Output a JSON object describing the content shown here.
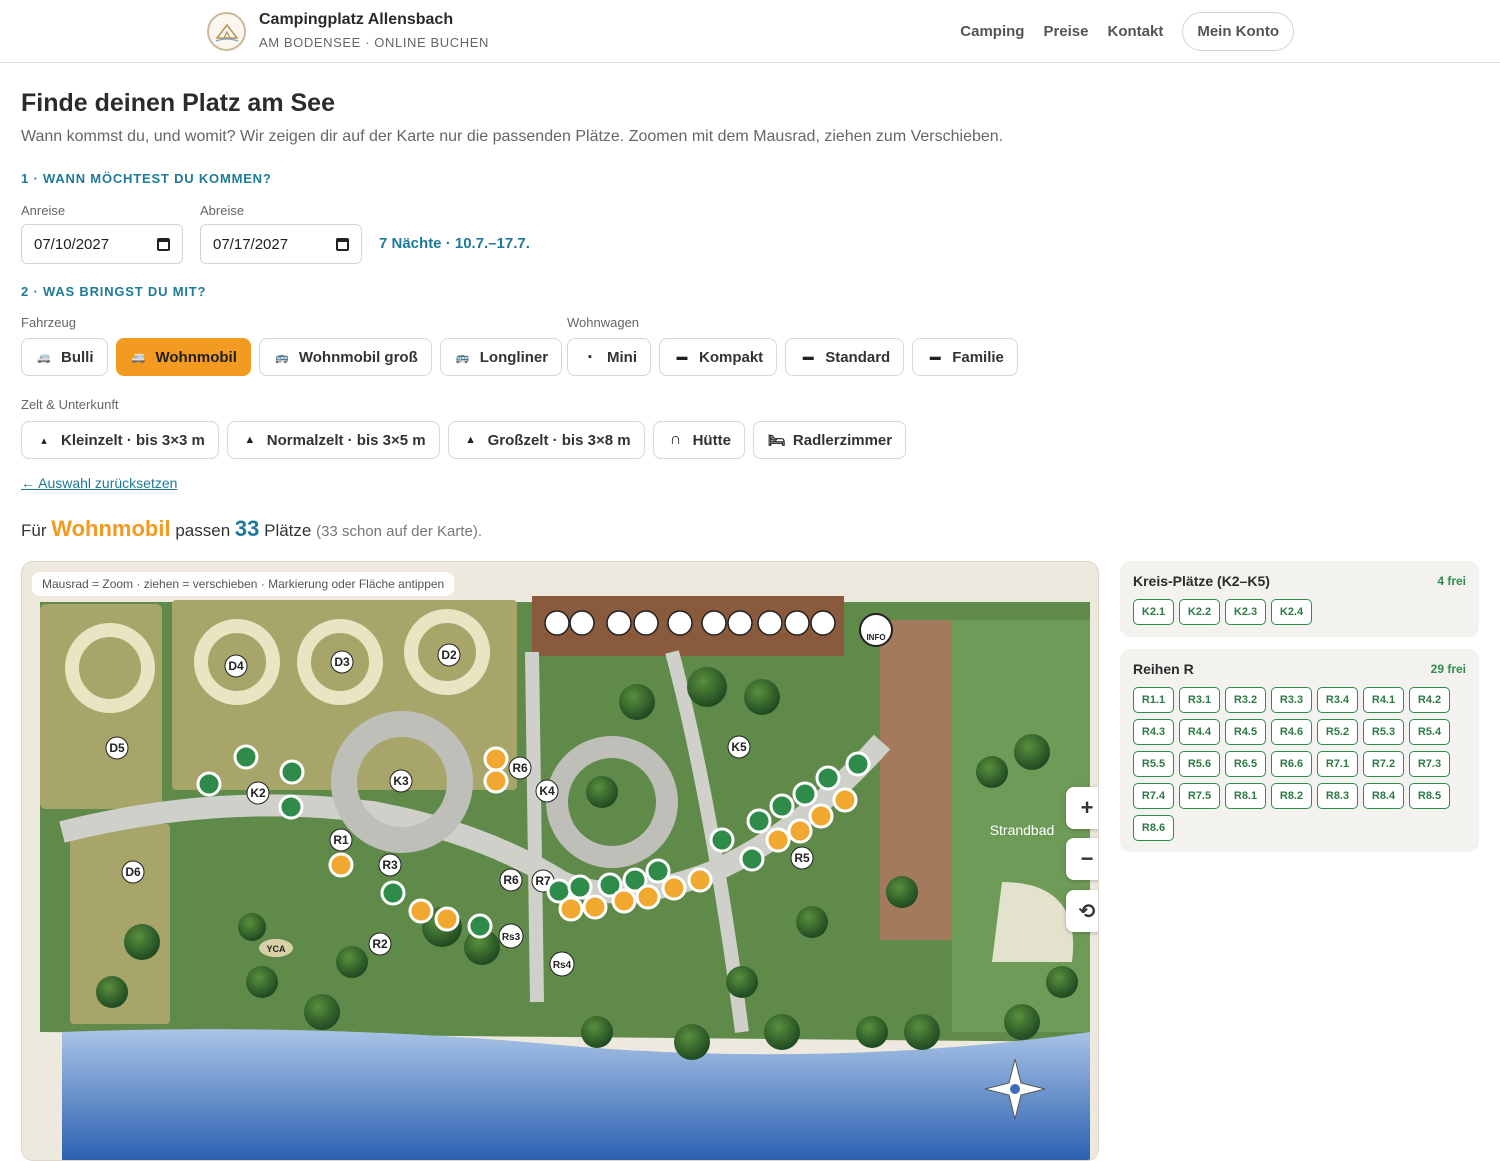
{
  "header": {
    "brand_title": "Campingplatz Allensbach",
    "brand_subtitle": "AM BODENSEE · ONLINE BUCHEN",
    "nav": [
      "Camping",
      "Preise",
      "Kontakt"
    ],
    "account": "Mein Konto"
  },
  "page": {
    "title": "Finde deinen Platz am See",
    "intro": "Wann kommst du, und womit? Wir zeigen dir auf der Karte nur die passenden Plätze. Zoomen mit dem Mausrad, ziehen zum Verschieben."
  },
  "step1": {
    "heading": "1 · WANN MÖCHTEST DU KOMMEN?",
    "arrival_label": "Anreise",
    "arrival_value": "07/10/2027",
    "departure_label": "Abreise",
    "departure_value": "07/17/2027",
    "nights": "7 Nächte · 10.7.–17.7."
  },
  "step2": {
    "heading": "2 · WAS BRINGST DU MIT?",
    "vehicle_label": "Fahrzeug",
    "vehicles": [
      "Bulli",
      "Wohnmobil",
      "Wohnmobil groß",
      "Longliner"
    ],
    "caravan_label": "Wohnwagen",
    "caravans": [
      "Mini",
      "Kompakt",
      "Standard",
      "Familie"
    ],
    "tent_label": "Zelt & Unterkunft",
    "tents": [
      "Kleinzelt · bis 3×3 m",
      "Normalzelt · bis 3×5 m",
      "Großzelt · bis 3×8 m",
      "Hütte",
      "Radlerzimmer"
    ],
    "selected": "Wohnmobil",
    "reset": "← Auswahl zurücksetzen"
  },
  "result": {
    "prefix": "Für",
    "vehicle": "Wohnmobil",
    "middle": "passen",
    "count": "33",
    "suffix": "Plätze",
    "note": "(33 schon auf der Karte)."
  },
  "map": {
    "hint": "Mausrad = Zoom · ziehen = verschieben · Markierung oder Fläche antippen",
    "zoom_in": "+",
    "zoom_out": "−",
    "reset_icon": "⟲",
    "labels": {
      "d5": "D5",
      "d4": "D4",
      "d3": "D3",
      "d2": "D2",
      "d6": "D6",
      "k2": "K2",
      "k3": "K3",
      "k4": "K4",
      "k5": "K5",
      "r1": "R1",
      "r2": "R2",
      "r3": "R3",
      "r5": "R5",
      "r6": "R6",
      "r6b": "R6",
      "r7": "R7",
      "rs3": "Rs3",
      "rs4": "Rs4",
      "yca": "YCA",
      "strandbad": "Strandbad",
      "info": "INFO"
    },
    "colors": {
      "free": "#2e8b4a",
      "partial": "#f0a830",
      "grass": "#5f8a4a",
      "lake": "#2f63b3"
    }
  },
  "panels": [
    {
      "title": "Kreis-Plätze (K2–K5)",
      "free": "4 frei",
      "spots": [
        "K2.1",
        "K2.2",
        "K2.3",
        "K2.4"
      ]
    },
    {
      "title": "Reihen R",
      "free": "29 frei",
      "spots": [
        "R1.1",
        "R3.1",
        "R3.2",
        "R3.3",
        "R3.4",
        "R4.1",
        "R4.2",
        "R4.3",
        "R4.4",
        "R4.5",
        "R4.6",
        "R5.2",
        "R5.3",
        "R5.4",
        "R5.5",
        "R5.6",
        "R6.5",
        "R6.6",
        "R7.1",
        "R7.2",
        "R7.3",
        "R7.4",
        "R7.5",
        "R8.1",
        "R8.2",
        "R8.3",
        "R8.4",
        "R8.5",
        "R8.6"
      ]
    }
  ]
}
